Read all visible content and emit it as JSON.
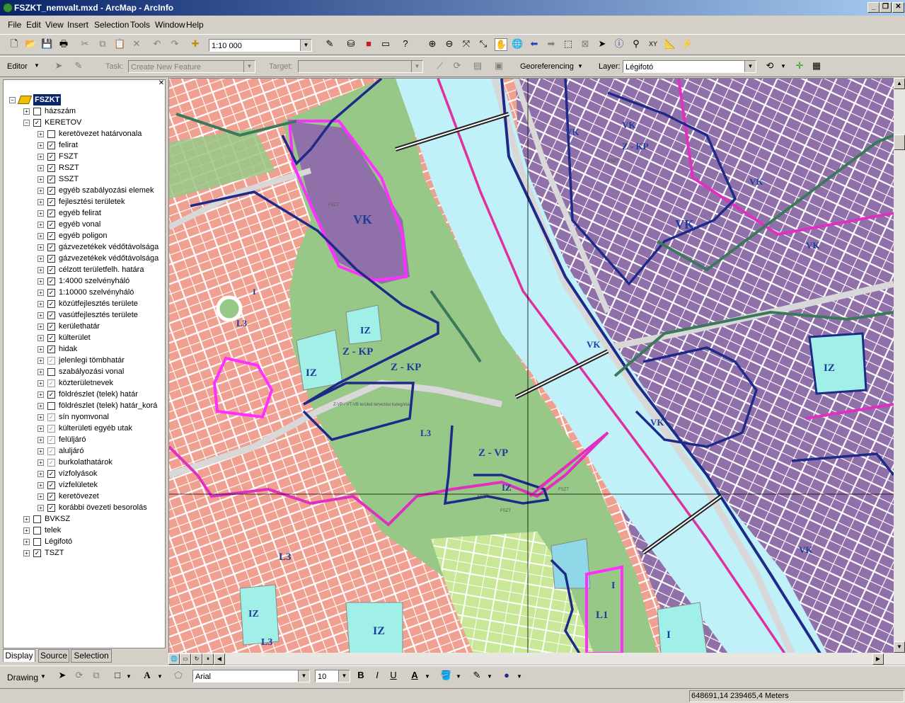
{
  "window": {
    "title": "FSZKT_nemvalt.mxd - ArcMap - ArcInfo"
  },
  "menu": [
    "File",
    "Edit",
    "View",
    "Insert",
    "Selection",
    "Tools",
    "Window",
    "Help"
  ],
  "standard": {
    "scale": "1:10 000"
  },
  "editor": {
    "editor_label": "Editor",
    "task_label": "Task:",
    "task_value": "Create New Feature",
    "target_label": "Target:",
    "target_value": "",
    "georef_label": "Georeferencing",
    "layer_label": "Layer:",
    "layer_value": "Légifotó"
  },
  "toc": {
    "root": "FSZKT",
    "layers": [
      {
        "name": "házszám",
        "level": 1,
        "checked": false,
        "expand": "+"
      },
      {
        "name": "KERETOV",
        "level": 1,
        "checked": true,
        "expand": "-"
      },
      {
        "name": "keretövezet határvonala",
        "level": 2,
        "checked": false,
        "expand": "+"
      },
      {
        "name": "felirat",
        "level": 2,
        "checked": true,
        "expand": "+"
      },
      {
        "name": "FSZT",
        "level": 2,
        "checked": true,
        "expand": "+"
      },
      {
        "name": "RSZT",
        "level": 2,
        "checked": true,
        "expand": "+"
      },
      {
        "name": "SSZT",
        "level": 2,
        "checked": true,
        "expand": "+"
      },
      {
        "name": "egyéb szabályozási elemek",
        "level": 2,
        "checked": true,
        "expand": "+"
      },
      {
        "name": "fejlesztési területek",
        "level": 2,
        "checked": true,
        "expand": "+"
      },
      {
        "name": "egyéb felirat",
        "level": 2,
        "checked": true,
        "expand": "+"
      },
      {
        "name": "egyéb vonal",
        "level": 2,
        "checked": true,
        "expand": "+"
      },
      {
        "name": "egyéb poligon",
        "level": 2,
        "checked": true,
        "expand": "+"
      },
      {
        "name": "gázvezetékek védőtávolsága",
        "level": 2,
        "checked": true,
        "expand": "+"
      },
      {
        "name": "gázvezetékek védőtávolsága",
        "level": 2,
        "checked": true,
        "expand": "+"
      },
      {
        "name": "célzott területfelh. határa",
        "level": 2,
        "checked": true,
        "expand": "+"
      },
      {
        "name": "1:4000 szelvényháló",
        "level": 2,
        "checked": true,
        "expand": "+"
      },
      {
        "name": "1:10000 szelvényháló",
        "level": 2,
        "checked": true,
        "expand": "+"
      },
      {
        "name": "közútfejlesztés területe",
        "level": 2,
        "checked": true,
        "expand": "+"
      },
      {
        "name": "vasútfejlesztés területe",
        "level": 2,
        "checked": true,
        "expand": "+"
      },
      {
        "name": "kerülethatár",
        "level": 2,
        "checked": true,
        "expand": "+"
      },
      {
        "name": "külterület",
        "level": 2,
        "checked": true,
        "expand": "+"
      },
      {
        "name": "hidak",
        "level": 2,
        "checked": true,
        "expand": "+"
      },
      {
        "name": "jelenlegi tömbhatár",
        "level": 2,
        "checked": "grey",
        "expand": "+"
      },
      {
        "name": "szabályozási vonal",
        "level": 2,
        "checked": false,
        "expand": "+"
      },
      {
        "name": "közterületnevek",
        "level": 2,
        "checked": "grey",
        "expand": "+"
      },
      {
        "name": "földrészlet (telek) határ",
        "level": 2,
        "checked": true,
        "expand": "+"
      },
      {
        "name": "földrészlet (telek) határ_korá",
        "level": 2,
        "checked": false,
        "expand": "+"
      },
      {
        "name": "sín nyomvonal",
        "level": 2,
        "checked": "grey",
        "expand": "+"
      },
      {
        "name": "külterületi egyéb utak",
        "level": 2,
        "checked": "grey",
        "expand": "+"
      },
      {
        "name": "felüljáró",
        "level": 2,
        "checked": "grey",
        "expand": "+"
      },
      {
        "name": "aluljáró",
        "level": 2,
        "checked": "grey",
        "expand": "+"
      },
      {
        "name": "burkolathatárok",
        "level": 2,
        "checked": "grey",
        "expand": "+"
      },
      {
        "name": "vízfolyások",
        "level": 2,
        "checked": true,
        "expand": "+"
      },
      {
        "name": "vízfelületek",
        "level": 2,
        "checked": true,
        "expand": "+"
      },
      {
        "name": "keretövezet",
        "level": 2,
        "checked": true,
        "expand": "+"
      },
      {
        "name": "korábbi övezeti besorolás",
        "level": 2,
        "checked": true,
        "expand": "+"
      },
      {
        "name": "BVKSZ",
        "level": 1,
        "checked": false,
        "expand": "+"
      },
      {
        "name": "telek",
        "level": 1,
        "checked": false,
        "expand": "+"
      },
      {
        "name": "Légifotó",
        "level": 1,
        "checked": false,
        "expand": "+"
      },
      {
        "name": "TSZT",
        "level": 1,
        "checked": true,
        "expand": "+"
      }
    ],
    "tabs": [
      "Display",
      "Source",
      "Selection"
    ]
  },
  "map": {
    "zone_labels": [
      "VK",
      "VK",
      "VK",
      "VK",
      "VK",
      "VK",
      "VK",
      "VK",
      "VK",
      "Z - KP",
      "Z - KP",
      "Z - KP",
      "Z - VP",
      "IZ",
      "IZ",
      "IZ",
      "IZ",
      "IZ",
      "IZ",
      "L3",
      "L3",
      "L3",
      "L3",
      "L1",
      "I",
      "I",
      "I"
    ],
    "small_text": [
      "FSZT",
      "FSZT",
      "FSZT",
      "Z-VP / VT-VB területi tervezési kategória",
      "ASZT",
      "FSZT"
    ],
    "colors": {
      "river": "#c0f0f8",
      "vk": "#9070a8",
      "residential": "#f0a090",
      "park": "#98c888",
      "iz": "#a0f0e8",
      "boundary_pink": "#e030c0",
      "boundary_navy": "#202880",
      "boundary_green": "#3a7a5a",
      "road": "#d8d8d8"
    }
  },
  "drawing": {
    "drawing_label": "Drawing",
    "font": "Arial",
    "size": "10",
    "bold": "B",
    "italic": "I",
    "underline": "U",
    "text_tool": "A"
  },
  "status": {
    "coordinates": "648691,14  239465,4 Meters"
  }
}
